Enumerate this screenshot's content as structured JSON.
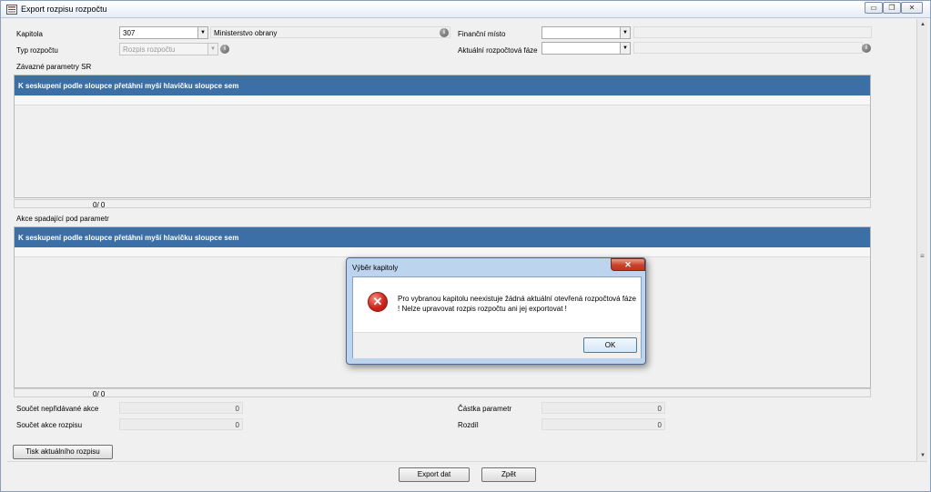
{
  "window": {
    "title": "Export rozpisu rozpočtu",
    "controls": {
      "minimize": "▭",
      "restore": "❐",
      "close": "✕"
    }
  },
  "form": {
    "kapitola_label": "Kapitola",
    "kapitola_value": "307",
    "kapitola_name": "Ministerstvo obrany",
    "typ_label": "Typ rozpočtu",
    "typ_value": "Rozpis rozpočtu",
    "financni_label": "Finanční místo",
    "financni_value": "",
    "faze_label": "Aktuální rozpočtová fáze",
    "faze_value": "",
    "info_glyph": "i"
  },
  "grid1": {
    "section_label": "Závazné parametry SR",
    "group_header": "K seskupení podle sloupce přetáhni myší hlavičku sloupce sem",
    "count": "0/ 0"
  },
  "grid2": {
    "section_label": "Akce spadající pod parametr",
    "group_header": "K seskupení podle sloupce přetáhni myší hlavičku sloupce sem",
    "count": "0/ 0"
  },
  "totals": {
    "soucet_neprid_label": "Součet nepřidávané akce",
    "soucet_neprid_value": "0",
    "soucet_akce_label": "Součet akce rozpisu",
    "soucet_akce_value": "0",
    "castka_label": "Částka parametr",
    "castka_value": "0",
    "rozdil_label": "Rozdíl",
    "rozdil_value": "0"
  },
  "buttons": {
    "tisk": "Tisk aktuálního rozpisu",
    "export": "Export dat",
    "zpet": "Zpět"
  },
  "dialog": {
    "title": "Výběr kapitoly",
    "close_glyph": "✕",
    "message": "Pro vybranou kapitolu neexistuje žádná aktuální otevřená rozpočtová fáze ! Nelze upravovat rozpis rozpočtu ani jej exportovat !",
    "ok": "OK",
    "icon_glyph": "✕"
  },
  "colors": {
    "grid_header": "#3c6fa6",
    "error_icon": "#d0261c",
    "close_button": "#c8412a"
  },
  "icons": [
    "app-icon",
    "dropdown-arrow-icon",
    "info-icon",
    "error-icon",
    "close-icon",
    "scroll-up-icon",
    "scroll-down-icon"
  ]
}
